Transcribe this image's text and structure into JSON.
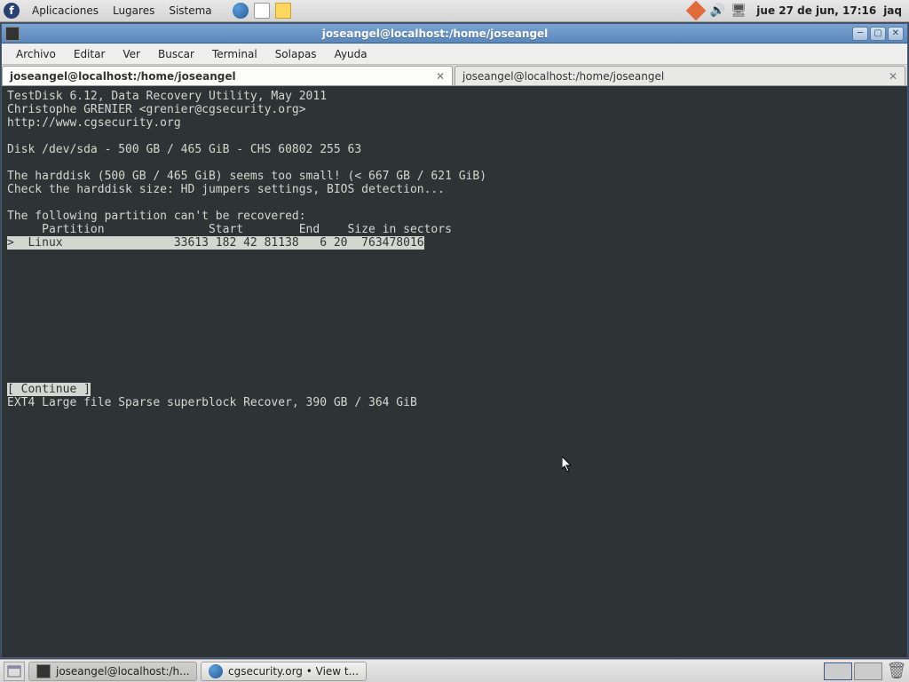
{
  "top_panel": {
    "menus": [
      "Aplicaciones",
      "Lugares",
      "Sistema"
    ],
    "clock": "jue 27 de jun, 17:16",
    "user": "jaq"
  },
  "window": {
    "title": "joseangel@localhost:/home/joseangel",
    "menubar": [
      "Archivo",
      "Editar",
      "Ver",
      "Buscar",
      "Terminal",
      "Solapas",
      "Ayuda"
    ],
    "tabs": [
      {
        "label": "joseangel@localhost:/home/joseangel",
        "active": true
      },
      {
        "label": "joseangel@localhost:/home/joseangel",
        "active": false
      }
    ]
  },
  "terminal": {
    "line1": "TestDisk 6.12, Data Recovery Utility, May 2011",
    "line2": "Christophe GRENIER <grenier@cgsecurity.org>",
    "line3": "http://www.cgsecurity.org",
    "line5": "Disk /dev/sda - 500 GB / 465 GiB - CHS 60802 255 63",
    "line7": "The harddisk (500 GB / 465 GiB) seems too small! (< 667 GB / 621 GiB)",
    "line8": "Check the harddisk size: HD jumpers settings, BIOS detection...",
    "line10": "The following partition can't be recovered:",
    "header": "     Partition               Start        End    Size in sectors",
    "row": ">  Linux                33613 182 42 81138   6 20  763478016",
    "continue_btn": "[ Continue ]",
    "footer": "EXT4 Large file Sparse superblock Recover, 390 GB / 364 GiB"
  },
  "bottom_panel": {
    "task1": "joseangel@localhost:/h...",
    "task2": "cgsecurity.org • View t..."
  }
}
